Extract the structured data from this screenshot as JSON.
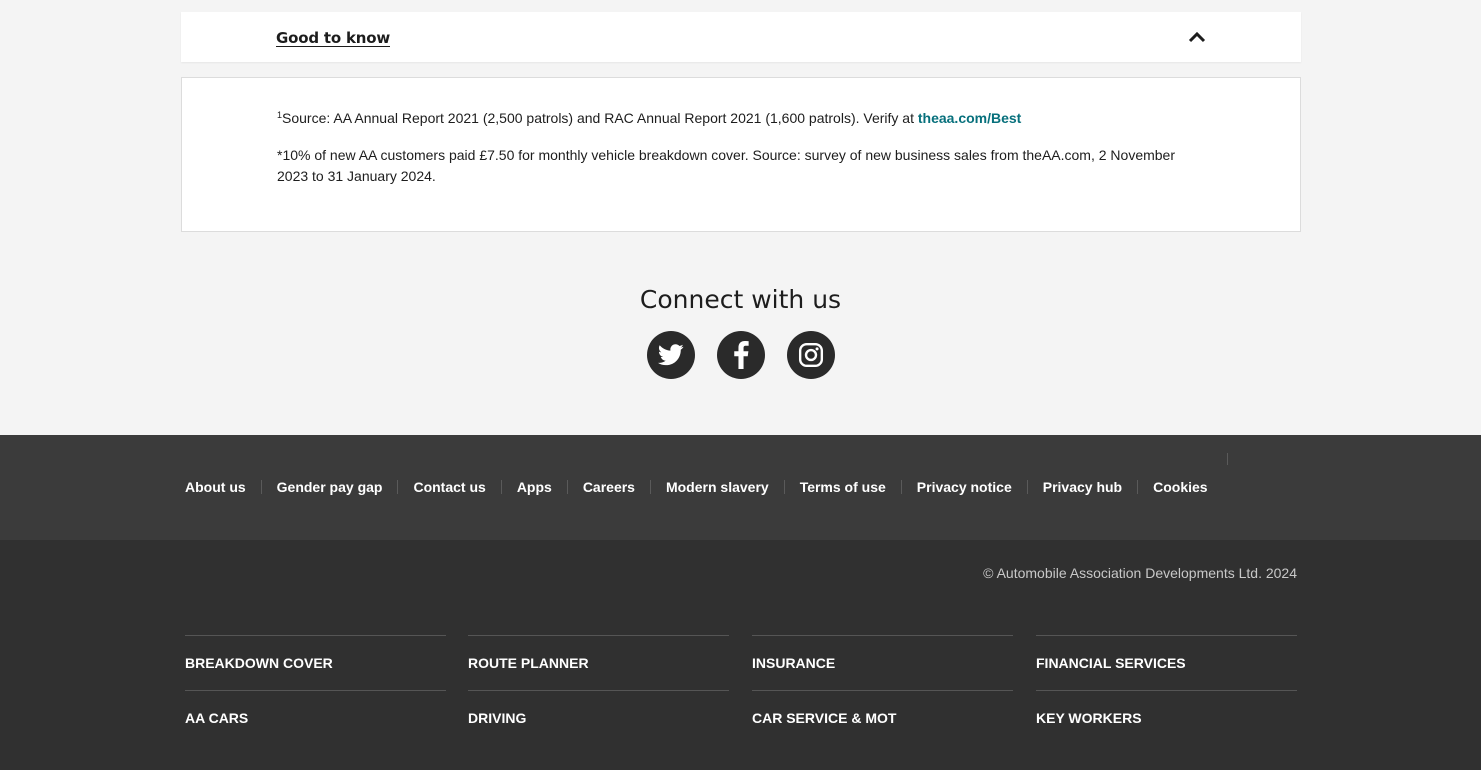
{
  "accordion": {
    "title": "Good to know",
    "footnote1_sup": "1",
    "footnote1_text": "Source: AA Annual Report 2021 (2,500 patrols) and RAC Annual Report 2021 (1,600 patrols). Verify at ",
    "footnote1_link": "theaa.com/Best",
    "footnote2_text": "*10% of new AA customers paid £7.50 for monthly vehicle breakdown cover. Source: survey of new business sales from theAA.com, 2 November 2023 to 31 January 2024."
  },
  "connect": {
    "title": "Connect with us",
    "icons": [
      "twitter-icon",
      "facebook-icon",
      "instagram-icon"
    ]
  },
  "footer_links": [
    "About us",
    "Gender pay gap",
    "Contact us",
    "Apps",
    "Careers",
    "Modern slavery",
    "Terms of use",
    "Privacy notice",
    "Privacy hub",
    "Cookies"
  ],
  "copyright": "© Automobile Association Developments Ltd. 2024",
  "categories": {
    "row1": [
      "BREAKDOWN COVER",
      "ROUTE PLANNER",
      "INSURANCE",
      "FINANCIAL SERVICES"
    ],
    "row2": [
      "AA CARS",
      "DRIVING",
      "CAR SERVICE & MOT",
      "KEY WORKERS"
    ]
  },
  "colors": {
    "page_bg": "#f4f4f4",
    "link_teal": "#07707c",
    "footer_links_bg": "#3b3b3b",
    "footer_bottom_bg": "#303030",
    "social_icon_bg": "#2a2a2a"
  }
}
